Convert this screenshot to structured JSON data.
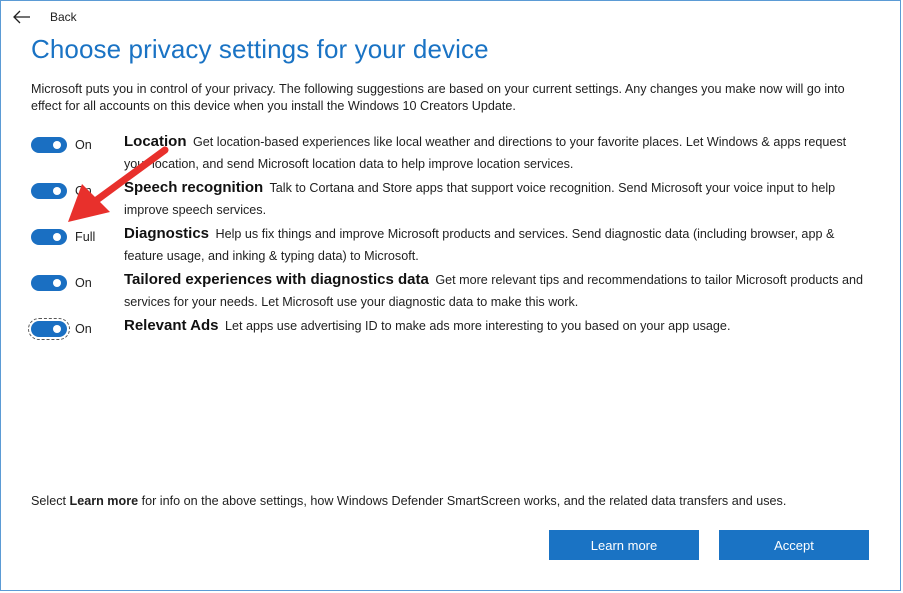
{
  "nav": {
    "back_label": "Back"
  },
  "page": {
    "title": "Choose privacy settings for your device",
    "intro": "Microsoft puts you in control of your privacy. The following suggestions are based on your current settings. Any changes you make now will go into effect for all accounts on this device when you install the Windows 10 Creators Update."
  },
  "settings": [
    {
      "state": "On",
      "title": "Location",
      "text": "Get location-based experiences like local weather and directions to your favorite places. Let Windows & apps request your location, and send Microsoft location data to help improve location services."
    },
    {
      "state": "On",
      "title": "Speech recognition",
      "text": "Talk to Cortana and Store apps that support voice recognition. Send Microsoft your voice input to help improve speech services."
    },
    {
      "state": "Full",
      "title": "Diagnostics",
      "text": "Help us fix things and improve Microsoft products and services. Send diagnostic data (including browser, app & feature usage, and inking & typing data) to Microsoft."
    },
    {
      "state": "On",
      "title": "Tailored experiences with diagnostics data",
      "text": "Get more relevant tips and recommendations to tailor Microsoft products and services for your needs. Let Microsoft use your diagnostic data to make this work."
    },
    {
      "state": "On",
      "title": "Relevant Ads",
      "text": "Let apps use advertising ID to make ads more interesting to you based on your app usage."
    }
  ],
  "footer": {
    "prefix": "Select ",
    "bold": "Learn more",
    "suffix": " for info on the above settings, how Windows Defender SmartScreen works, and the related data transfers and uses."
  },
  "buttons": {
    "learn_more": "Learn more",
    "accept": "Accept"
  },
  "colors": {
    "accent": "#1a73c4",
    "toggle_on": "#1a6fc2",
    "annotation": "#e8302c"
  }
}
